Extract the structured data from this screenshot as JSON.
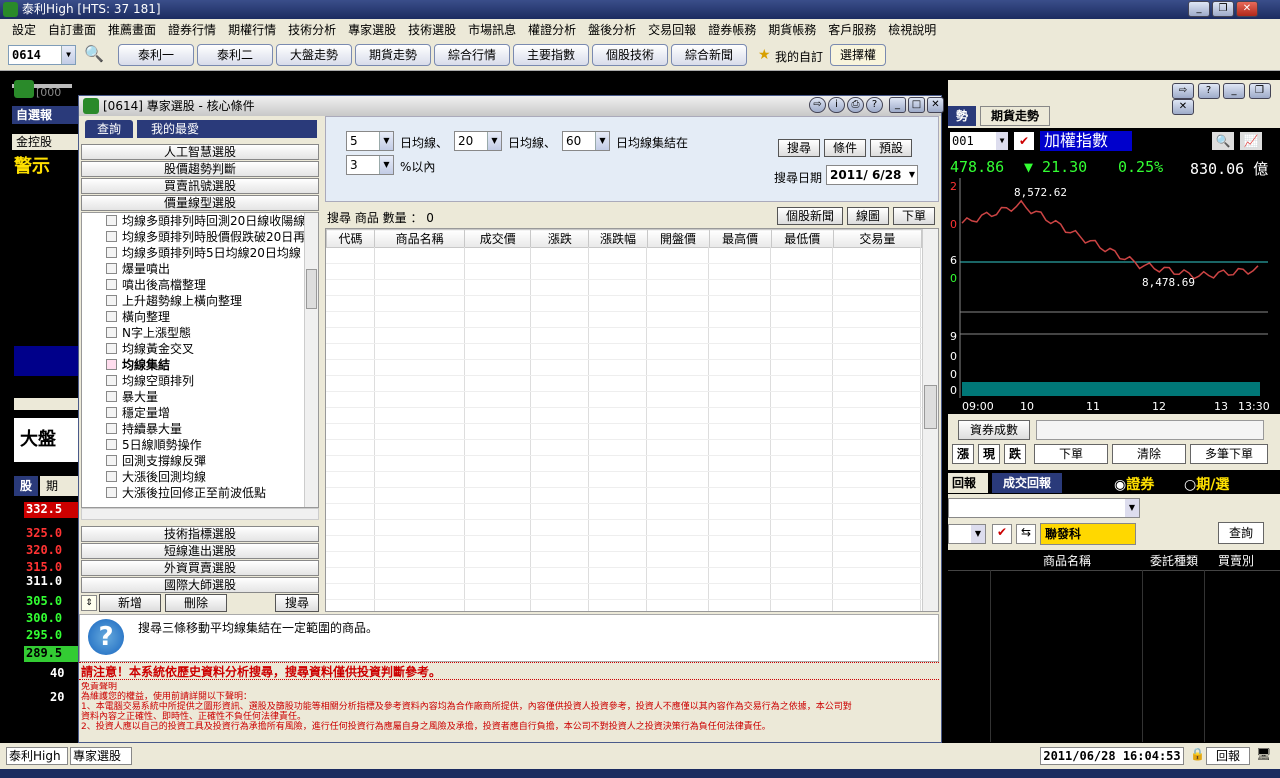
{
  "app": {
    "title": "泰利High  [HTS: 37 181]"
  },
  "menu": [
    "設定",
    "自訂畫面",
    "推薦畫面",
    "證券行情",
    "期權行情",
    "技術分析",
    "專家選股",
    "技術選股",
    "市場訊息",
    "權證分析",
    "盤後分析",
    "交易回報",
    "證券帳務",
    "期貨帳務",
    "客戶服務",
    "檢視說明"
  ],
  "toolbar": {
    "code": "0614",
    "buttons": [
      "泰利一",
      "泰利二",
      "大盤走勢",
      "期貨走勢",
      "綜合行情",
      "主要指數",
      "個股技術",
      "綜合新聞"
    ],
    "fav": "我的自訂",
    "opt": "選擇權"
  },
  "left": {
    "tab1": "自選報",
    "tab2": "金控股",
    "alert": "警示",
    "big": "大盤",
    "tabs": [
      "股",
      "期"
    ],
    "prices": [
      "332.5",
      "325.0",
      "320.0",
      "315.0",
      "311.0",
      "305.0",
      "300.0",
      "295.0",
      "289.5",
      "40",
      "20"
    ],
    "partial": "[000"
  },
  "dialog": {
    "title": "[0614] 專家選股 - 核心條件",
    "tabs": [
      "查詢",
      "我的最愛"
    ],
    "top_sections": [
      "人工智慧選股",
      "股價趨勢判斷",
      "買賣訊號選股",
      "價量線型選股"
    ],
    "tree_items": [
      "均線多頭排列時回測20日線收陽線",
      "均線多頭排列時股價假跌破20日再",
      "均線多頭排列時5日均線20日均線",
      "爆量噴出",
      "噴出後高檔整理",
      "上升趨勢線上橫向整理",
      "橫向整理",
      "N字上漲型態",
      "均線黃金交叉",
      "均線集結",
      "均線空頭排列",
      "暴大量",
      "穩定量增",
      "持續暴大量",
      "5日線順勢操作",
      "回測支撐線反彈",
      "大漲後回測均線",
      "大漲後拉回修正至前波低點"
    ],
    "selected": "均線集結",
    "bottom_sections": [
      "技術指標選股",
      "短線進出選股",
      "外資買賣選股",
      "國際大師選股"
    ],
    "btn_add": "新增",
    "btn_del": "刪除",
    "btn_search": "搜尋",
    "params": {
      "p1": "5",
      "l1": "日均線、",
      "p2": "20",
      "l2": "日均線、",
      "p3": "60",
      "l3": "日均線集結在",
      "p4": "3",
      "l4": "%以內"
    },
    "actions": [
      "搜尋",
      "條件",
      "預設"
    ],
    "date_label": "搜尋日期",
    "date": "2011/ 6/28",
    "result": "搜尋 商品 數量 ： 0",
    "result_btns": [
      "個股新聞",
      "線圖",
      "下單"
    ],
    "cols": [
      "代碼",
      "商品名稱",
      "成交價",
      "漲跌",
      "漲跌幅",
      "開盤價",
      "最高價",
      "最低價",
      "交易量"
    ],
    "info": "搜尋三條移動平均線集結在一定範圍的商品。",
    "warning": "請注意！本系統依歷史資料分析搜尋，搜尋資料僅供投資判斷參考。",
    "disclaimer": "免責聲明",
    "disclaimer_lines": [
      "為維護您的權益，使用前請詳閱以下聲明：",
      "1、本電腦交易系統中所提供之圖形資訊、選股及篩股功能等相關分析指標及參考資料內容均為合作廠商所提供，內容僅供投資人投資參考，投資人不應僅以其內容作為交易行為之依據，本公司對",
      "      資料內容之正確性、即時性、正確性不負任何法律責任。",
      "2、投資人應以自己的投資工具及投資行為承擔所有風險，進行任何投資行為應屬自身之風險及承擔，投資者應自行負擔，本公司不對投資人之投資決策行為負任何法律責任。"
    ]
  },
  "right": {
    "tabs": [
      "勢",
      "期貨走勢"
    ],
    "code": "001",
    "index": "加權指數",
    "price": "478.86",
    "change": "▼ 21.30",
    "pct": "0.25%",
    "vol": "830.06 億",
    "high": "8,572.62",
    "low": "8,478.69",
    "times": [
      "09:00",
      "10",
      "11",
      "12",
      "13",
      "13:30"
    ],
    "ylabels": [
      "2",
      "0",
      "6",
      "0",
      "9",
      "0",
      "0",
      "0"
    ],
    "margin": "資券成數",
    "buttons": [
      "漲",
      "現",
      "跌"
    ],
    "order": "下單",
    "clear": "清除",
    "multi": "多筆下單",
    "tabs2": [
      "回報",
      "成交回報"
    ],
    "radio1": "證券",
    "radio2": "期/選",
    "stock": "聯發科",
    "query": "查詢",
    "cols": [
      "商品名稱",
      "委託種類",
      "買賣別"
    ]
  },
  "chart_data": {
    "type": "line",
    "x": [
      "09:00",
      "10",
      "11",
      "12",
      "13",
      "13:30"
    ],
    "values": [
      8540,
      8560,
      8525,
      8495,
      8483,
      8490
    ],
    "high": 8572.62,
    "low": 8478.69,
    "title": "加權指數"
  },
  "status": {
    "tab1": "泰利High",
    "tab2": "專家選股",
    "time": "2011/06/28 16:04:53",
    "report": "回報"
  }
}
